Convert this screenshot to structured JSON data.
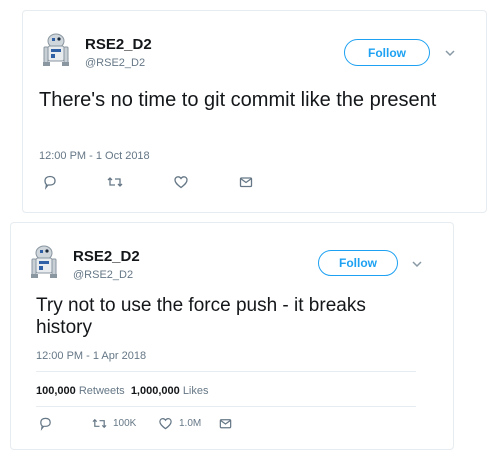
{
  "colors": {
    "accent": "#1da1f2",
    "muted": "#657786",
    "text": "#14171a"
  },
  "tweets": [
    {
      "name": "RSE2_D2",
      "handle": "@RSE2_D2",
      "follow_label": "Follow",
      "text": "There's no time to git commit like the present",
      "timestamp": "12:00 PM - 1 Oct 2018",
      "icons": [
        "reply-icon",
        "retweet-icon",
        "like-icon",
        "message-icon"
      ]
    },
    {
      "name": "RSE2_D2",
      "handle": "@RSE2_D2",
      "follow_label": "Follow",
      "text": "Try not to use the force push - it breaks history",
      "timestamp": "12:00 PM - 1 Apr 2018",
      "retweets_count": "100,000",
      "retweets_label": "Retweets",
      "likes_count": "1,000,000",
      "likes_label": "Likes",
      "retweet_short": "100K",
      "like_short": "1.0M",
      "icons": [
        "reply-icon",
        "retweet-icon",
        "like-icon",
        "message-icon"
      ]
    }
  ]
}
